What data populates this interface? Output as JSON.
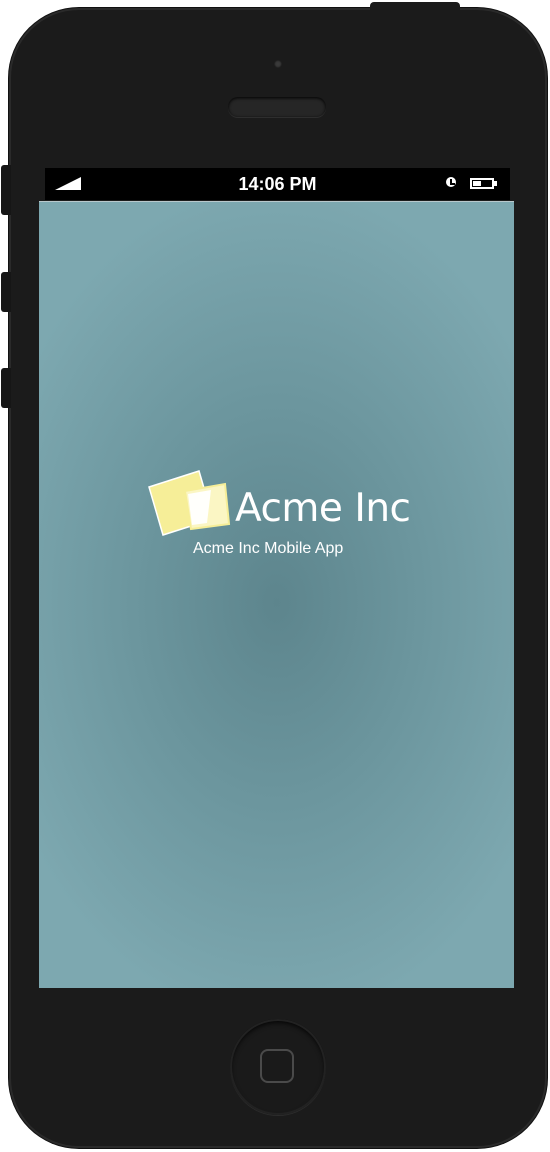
{
  "status_bar": {
    "time": "14:06 PM",
    "signal_icon": "signal-icon",
    "alarm_icon": "clock-icon",
    "battery_icon": "battery-icon",
    "battery_level": 0.45
  },
  "splash": {
    "brand_name": "Acme Inc",
    "subtitle": "Acme Inc Mobile App",
    "logo_icon": "overlapping-cards-logo",
    "background_color": "#6b959d",
    "logo_colors": [
      "#f5ed96",
      "#ffffff"
    ]
  },
  "device": {
    "home_button_icon": "home-button",
    "frame_color": "#1b1b1b"
  }
}
